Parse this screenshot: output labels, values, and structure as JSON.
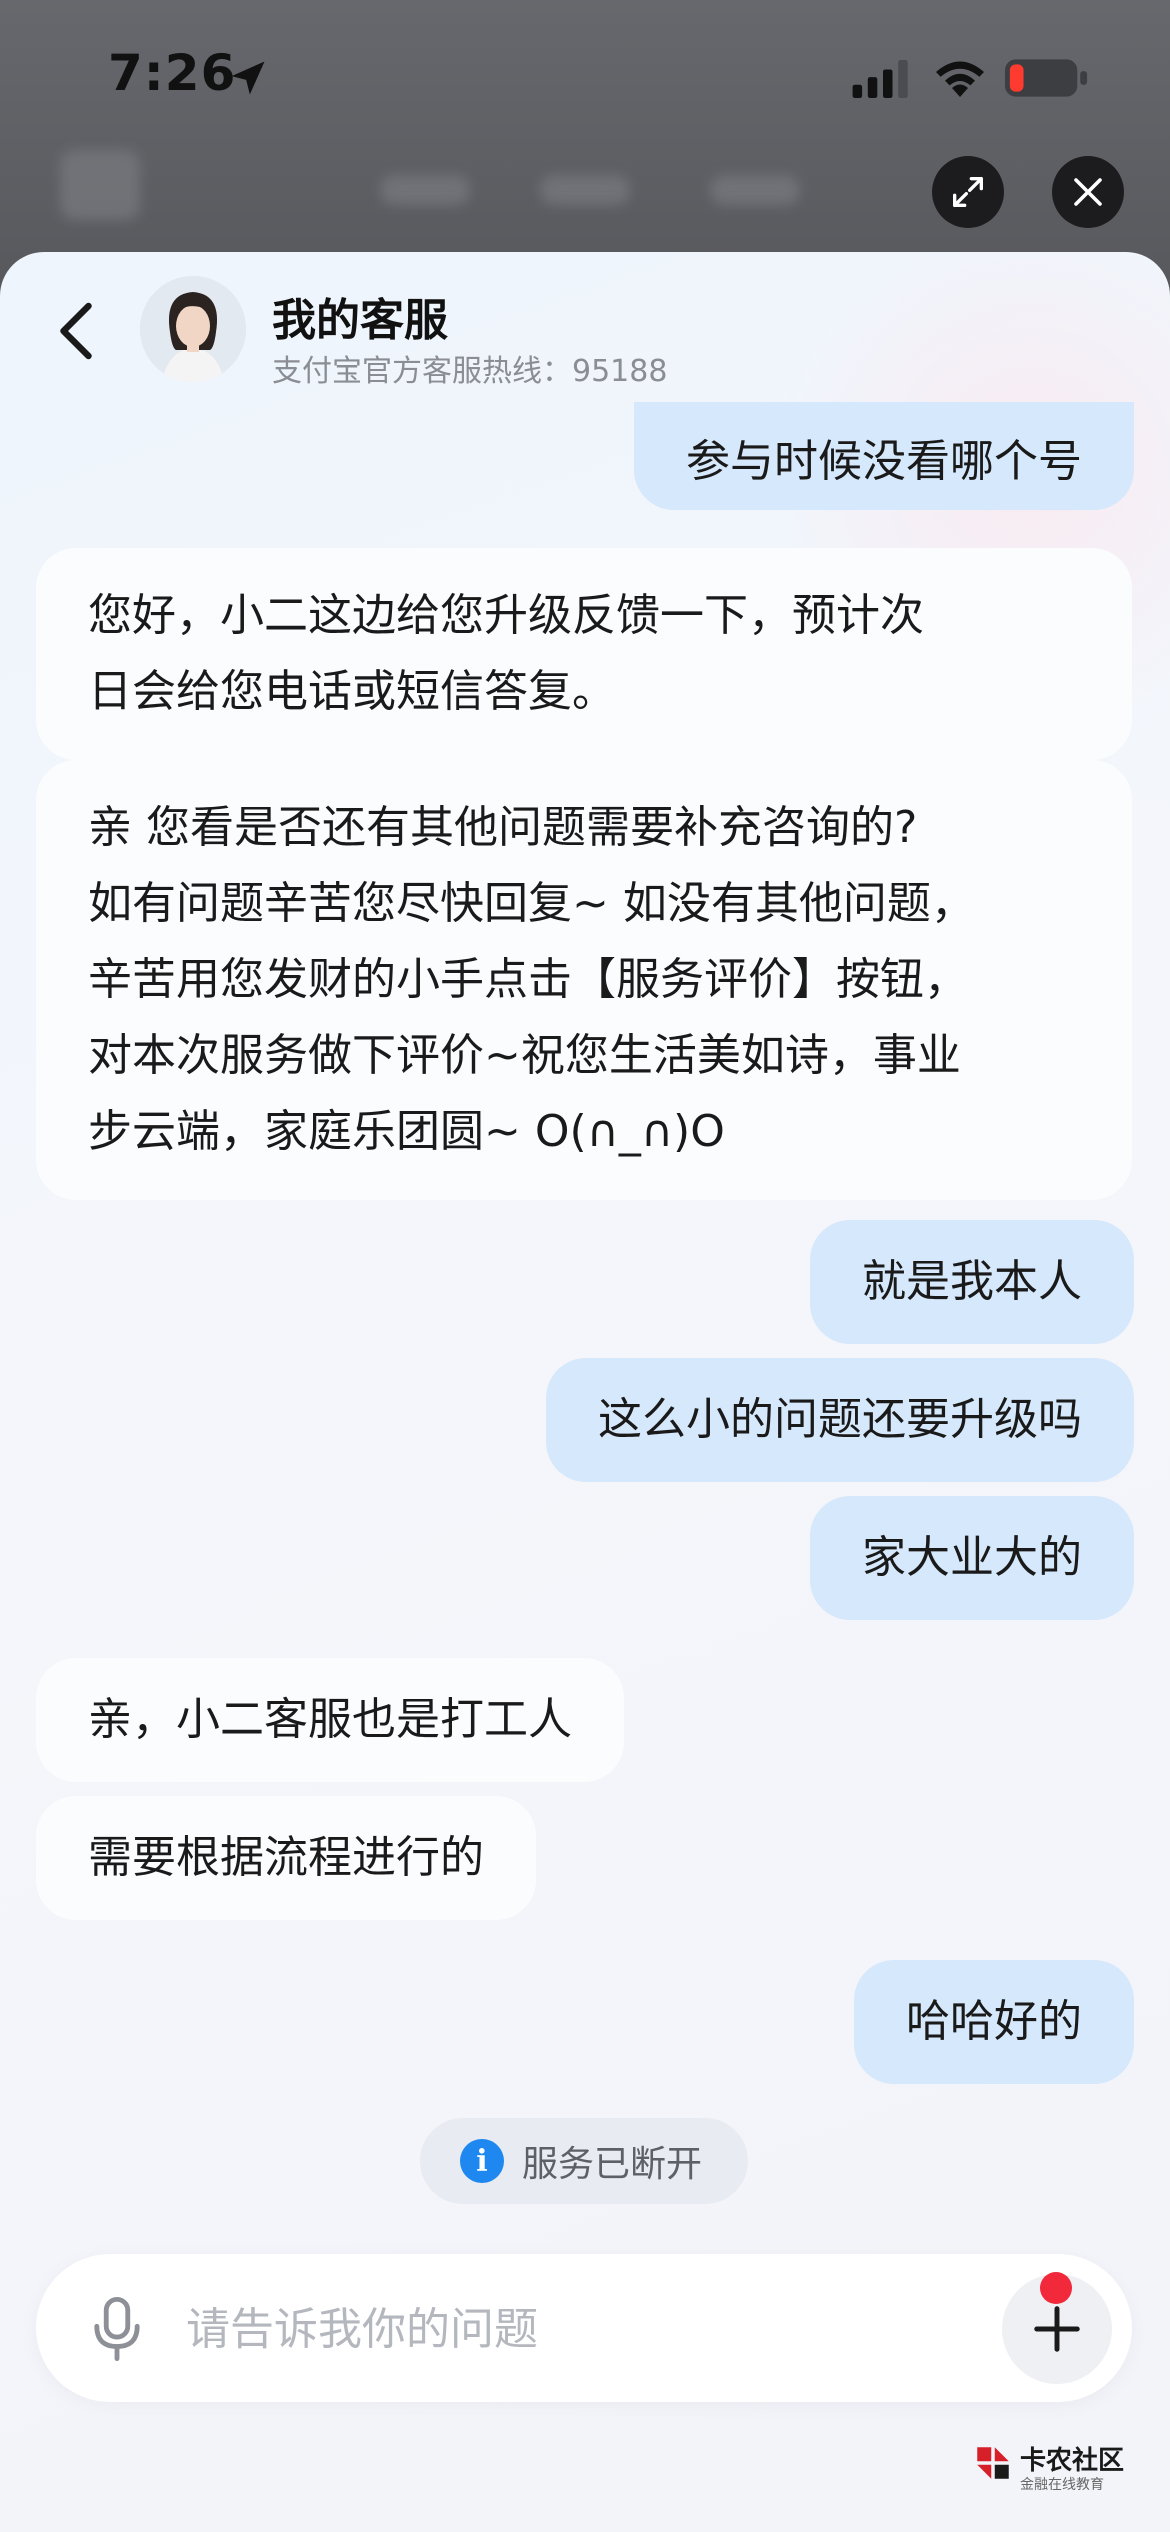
{
  "status_bar": {
    "time": "7:26"
  },
  "header": {
    "title": "我的客服",
    "subtitle": "支付宝官方客服热线：95188"
  },
  "messages": [
    {
      "role": "user",
      "lines": [
        "参与时候没看哪个号"
      ]
    },
    {
      "role": "agent",
      "lines": [
        "您好，小二这边给您升级反馈一下，预计次",
        "日会给您电话或短信答复。"
      ]
    },
    {
      "role": "agent",
      "lines": [
        "亲 您看是否还有其他问题需要补充咨询的?",
        "如有问题辛苦您尽快回复~ 如没有其他问题，",
        "辛苦用您发财的小手点击【服务评价】按钮，",
        "对本次服务做下评价~祝您生活美如诗，事业",
        "步云端，家庭乐团圆~ O(∩_∩)O"
      ]
    },
    {
      "role": "user",
      "lines": [
        "就是我本人"
      ]
    },
    {
      "role": "user",
      "lines": [
        "这么小的问题还要升级吗"
      ]
    },
    {
      "role": "user",
      "lines": [
        "家大业大的"
      ]
    },
    {
      "role": "agent",
      "lines": [
        "亲，小二客服也是打工人"
      ]
    },
    {
      "role": "agent",
      "lines": [
        "需要根据流程进行的"
      ]
    },
    {
      "role": "user",
      "lines": [
        "哈哈好的"
      ]
    }
  ],
  "notice": {
    "icon": "info-icon",
    "text": "服务已断开"
  },
  "input": {
    "placeholder": "请告诉我你的问题",
    "value": ""
  },
  "watermark": {
    "title": "卡农社区",
    "subtitle": "金融在线教育"
  },
  "colors": {
    "user_bubble": "#d6e8fb",
    "agent_bubble": "#fbfcfe",
    "notice_icon": "#1e88f0",
    "badge_red": "#f2283b"
  }
}
